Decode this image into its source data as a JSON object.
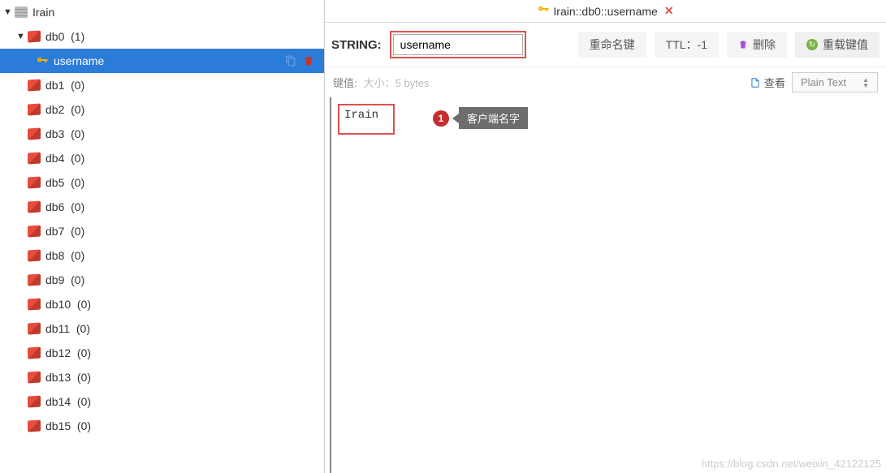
{
  "sidebar": {
    "server": {
      "name": "Irain"
    },
    "open_db": {
      "name": "db0",
      "count": "(1)"
    },
    "selected_key": {
      "name": "username"
    },
    "databases": [
      {
        "name": "db1",
        "count": "(0)"
      },
      {
        "name": "db2",
        "count": "(0)"
      },
      {
        "name": "db3",
        "count": "(0)"
      },
      {
        "name": "db4",
        "count": "(0)"
      },
      {
        "name": "db5",
        "count": "(0)"
      },
      {
        "name": "db6",
        "count": "(0)"
      },
      {
        "name": "db7",
        "count": "(0)"
      },
      {
        "name": "db8",
        "count": "(0)"
      },
      {
        "name": "db9",
        "count": "(0)"
      },
      {
        "name": "db10",
        "count": "(0)"
      },
      {
        "name": "db11",
        "count": "(0)"
      },
      {
        "name": "db12",
        "count": "(0)"
      },
      {
        "name": "db13",
        "count": "(0)"
      },
      {
        "name": "db14",
        "count": "(0)"
      },
      {
        "name": "db15",
        "count": "(0)"
      }
    ]
  },
  "tab": {
    "title": "Irain::db0::username"
  },
  "toolbar": {
    "type_label": "STRING:",
    "key_value": "username",
    "rename_label": "重命名键",
    "ttl_label": "TTL：-1",
    "delete_label": "删除",
    "reload_label": "重载键值"
  },
  "subbar": {
    "label": "键值:",
    "size_hint": "大小：5 bytes",
    "view_label": "查看",
    "format_value": "Plain Text"
  },
  "content": {
    "value": "Irain"
  },
  "annotation": {
    "num": "1",
    "text": "客户端名字"
  },
  "watermark": "https://blog.csdn.net/weixin_42122125"
}
